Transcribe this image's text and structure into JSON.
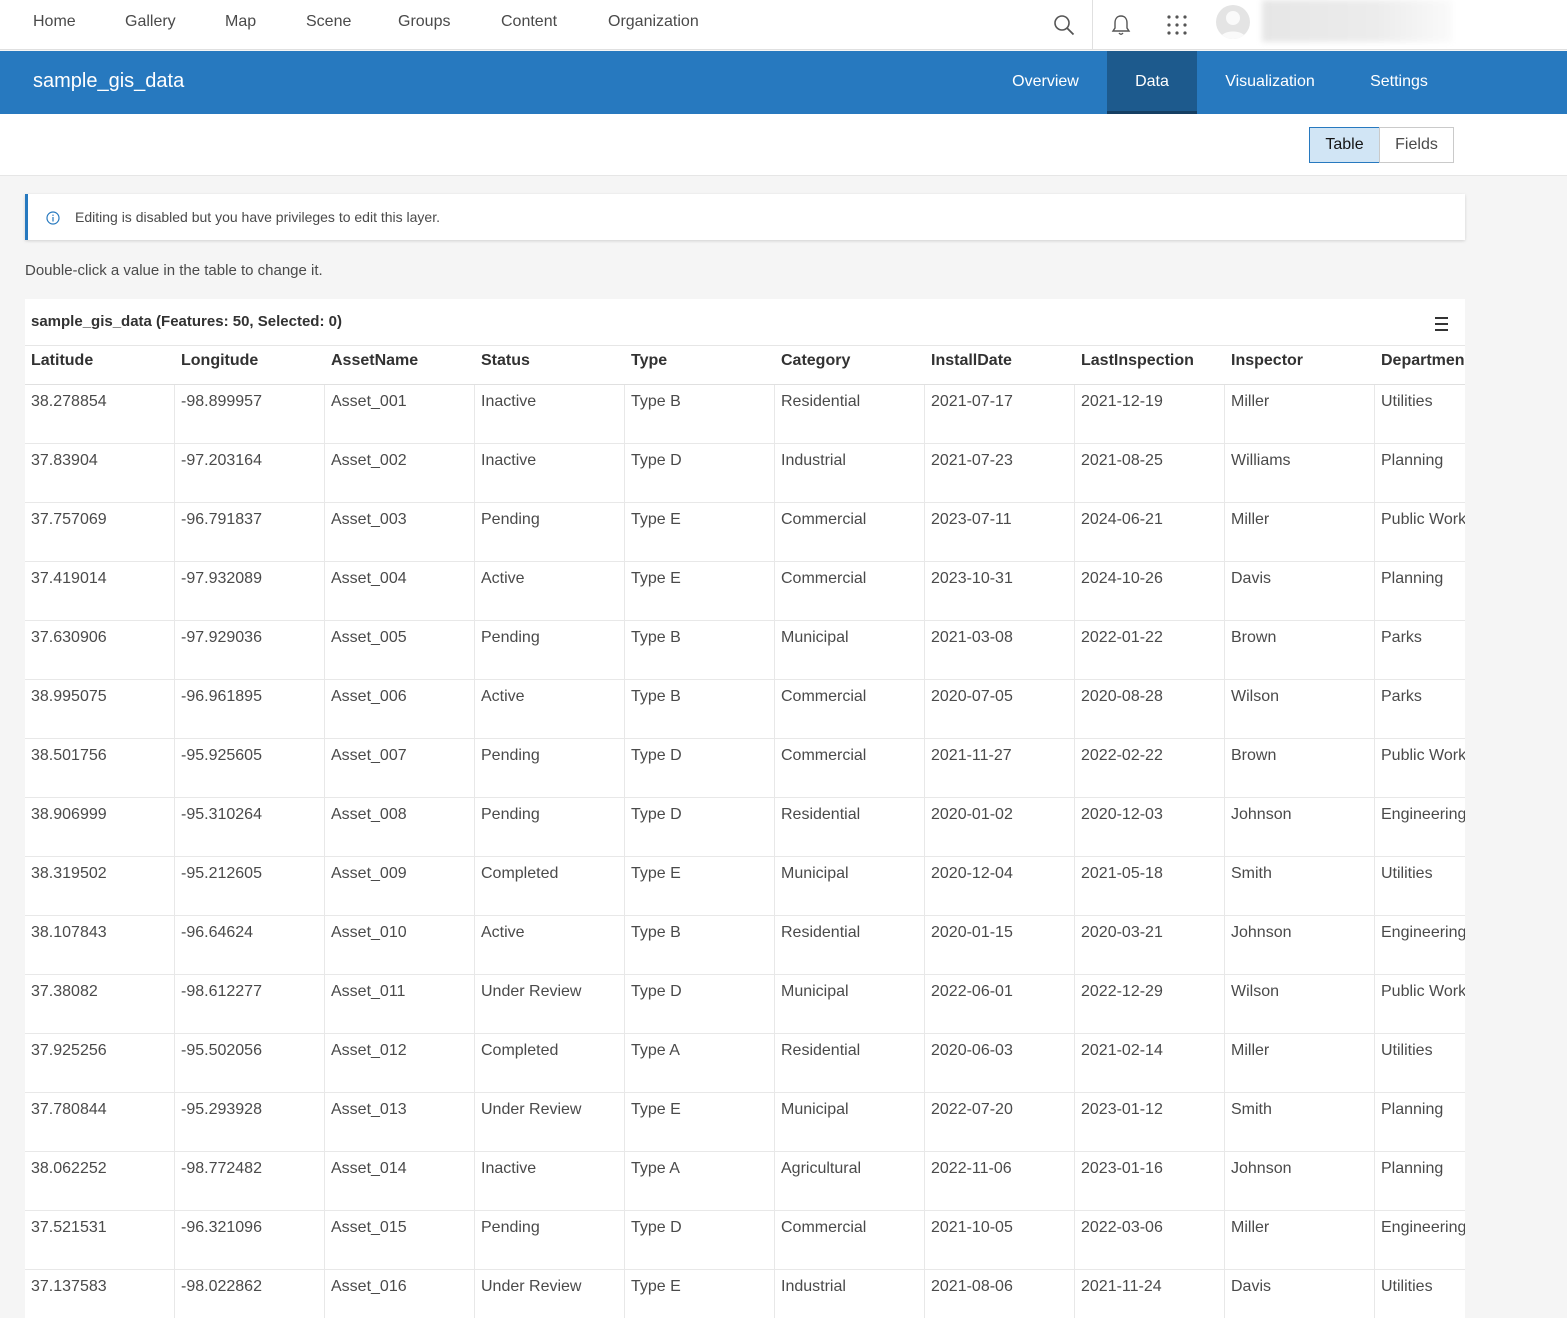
{
  "nav": {
    "links": [
      "Home",
      "Gallery",
      "Map",
      "Scene",
      "Groups",
      "Content",
      "Organization"
    ],
    "icons": [
      "search-icon",
      "bell-icon",
      "app-launcher-icon",
      "user-avatar-icon"
    ]
  },
  "item": {
    "title": "sample_gis_data",
    "tabs": [
      "Overview",
      "Data",
      "Visualization",
      "Settings"
    ],
    "active_tab": "Data"
  },
  "view_toggle": {
    "table": "Table",
    "fields": "Fields",
    "active": "Table"
  },
  "notice": {
    "message": "Editing is disabled but you have privileges to edit this layer."
  },
  "hint": "Double-click a value in the table to change it.",
  "table": {
    "caption": "sample_gis_data (Features: 50, Selected: 0)",
    "columns": [
      "Latitude",
      "Longitude",
      "AssetName",
      "Status",
      "Type",
      "Category",
      "InstallDate",
      "LastInspection",
      "Inspector",
      "Departmen"
    ],
    "rows": [
      [
        "38.278854",
        "-98.899957",
        "Asset_001",
        "Inactive",
        "Type B",
        "Residential",
        "2021-07-17",
        "2021-12-19",
        "Miller",
        "Utilities"
      ],
      [
        "37.83904",
        "-97.203164",
        "Asset_002",
        "Inactive",
        "Type D",
        "Industrial",
        "2021-07-23",
        "2021-08-25",
        "Williams",
        "Planning"
      ],
      [
        "37.757069",
        "-96.791837",
        "Asset_003",
        "Pending",
        "Type E",
        "Commercial",
        "2023-07-11",
        "2024-06-21",
        "Miller",
        "Public Work"
      ],
      [
        "37.419014",
        "-97.932089",
        "Asset_004",
        "Active",
        "Type E",
        "Commercial",
        "2023-10-31",
        "2024-10-26",
        "Davis",
        "Planning"
      ],
      [
        "37.630906",
        "-97.929036",
        "Asset_005",
        "Pending",
        "Type B",
        "Municipal",
        "2021-03-08",
        "2022-01-22",
        "Brown",
        "Parks"
      ],
      [
        "38.995075",
        "-96.961895",
        "Asset_006",
        "Active",
        "Type B",
        "Commercial",
        "2020-07-05",
        "2020-08-28",
        "Wilson",
        "Parks"
      ],
      [
        "38.501756",
        "-95.925605",
        "Asset_007",
        "Pending",
        "Type D",
        "Commercial",
        "2021-11-27",
        "2022-02-22",
        "Brown",
        "Public Work"
      ],
      [
        "38.906999",
        "-95.310264",
        "Asset_008",
        "Pending",
        "Type D",
        "Residential",
        "2020-01-02",
        "2020-12-03",
        "Johnson",
        "Engineering"
      ],
      [
        "38.319502",
        "-95.212605",
        "Asset_009",
        "Completed",
        "Type E",
        "Municipal",
        "2020-12-04",
        "2021-05-18",
        "Smith",
        "Utilities"
      ],
      [
        "38.107843",
        "-96.64624",
        "Asset_010",
        "Active",
        "Type B",
        "Residential",
        "2020-01-15",
        "2020-03-21",
        "Johnson",
        "Engineering"
      ],
      [
        "37.38082",
        "-98.612277",
        "Asset_011",
        "Under Review",
        "Type D",
        "Municipal",
        "2022-06-01",
        "2022-12-29",
        "Wilson",
        "Public Work"
      ],
      [
        "37.925256",
        "-95.502056",
        "Asset_012",
        "Completed",
        "Type A",
        "Residential",
        "2020-06-03",
        "2021-02-14",
        "Miller",
        "Utilities"
      ],
      [
        "37.780844",
        "-95.293928",
        "Asset_013",
        "Under Review",
        "Type E",
        "Municipal",
        "2022-07-20",
        "2023-01-12",
        "Smith",
        "Planning"
      ],
      [
        "38.062252",
        "-98.772482",
        "Asset_014",
        "Inactive",
        "Type A",
        "Agricultural",
        "2022-11-06",
        "2023-01-16",
        "Johnson",
        "Planning"
      ],
      [
        "37.521531",
        "-96.321096",
        "Asset_015",
        "Pending",
        "Type D",
        "Commercial",
        "2021-10-05",
        "2022-03-06",
        "Miller",
        "Engineering"
      ],
      [
        "37.137583",
        "-98.022862",
        "Asset_016",
        "Under Review",
        "Type E",
        "Industrial",
        "2021-08-06",
        "2021-11-24",
        "Davis",
        "Utilities"
      ]
    ]
  },
  "colors": {
    "header_blue": "#2779bf",
    "active_tab": "#1d5a8d",
    "toggle_active": "#d1e5f5"
  }
}
